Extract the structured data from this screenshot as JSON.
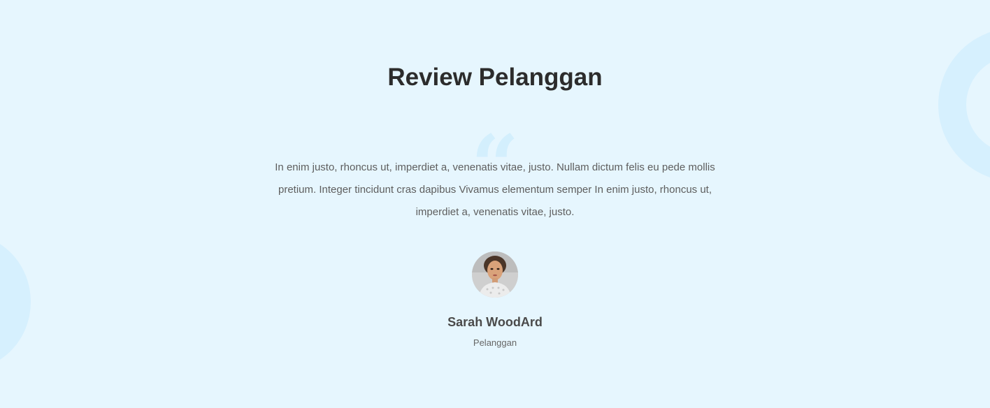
{
  "section": {
    "title": "Review Pelanggan",
    "quote_icon": "quote-icon",
    "review": {
      "text": "In enim justo, rhoncus ut, imperdiet a, venenatis vitae, justo. Nullam dictum felis eu pede mollis pretium. Integer tincidunt cras dapibus Vivamus elementum semper In enim justo, rhoncus ut, imperdiet a, venenatis vitae, justo."
    },
    "reviewer": {
      "name": "Sarah WoodArd",
      "role": "Pelanggan",
      "avatar_icon": "avatar-photo"
    }
  },
  "colors": {
    "background": "#e6f6fe",
    "decoration": "#d6f0fe",
    "title": "#2c2c2c",
    "body_text": "#5e5e5e"
  }
}
